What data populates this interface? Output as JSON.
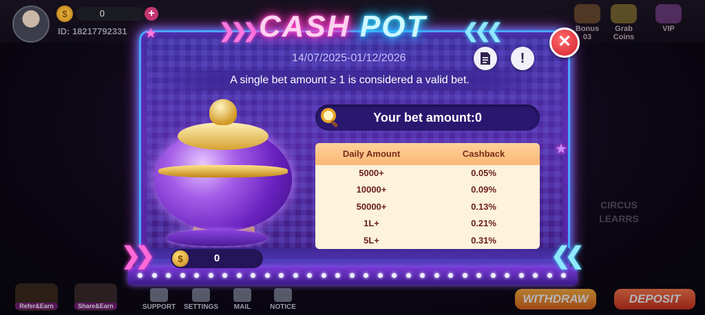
{
  "lobby": {
    "balance": "0",
    "uid": "ID: 18217792331",
    "top_items": [
      "Bonus",
      "Grab Coins",
      "VIP"
    ],
    "bonus_count": "03",
    "bottom_nav": [
      "Refer&Earn",
      "Share&Earn",
      "SUPPORT",
      "SETTINGS",
      "MAIL",
      "NOTICE"
    ],
    "withdraw_label": "WITHDRAW",
    "deposit_label": "DEPOSIT",
    "circus_text": "CIRCUS LEARRS"
  },
  "modal": {
    "title_part1": "CASH",
    "title_part2": "POT",
    "date_range": "14/07/2025-01/12/2026",
    "rules_icon": "document-icon",
    "info_icon": "exclamation-icon",
    "close_icon": "close-icon",
    "rule_text": "A single bet amount ≥ 1 is considered a valid bet.",
    "bet_amount_text": "Your bet amount:0",
    "pot_amount": "0",
    "table": {
      "headers": [
        "Daily Amount",
        "Cashback"
      ],
      "rows": [
        [
          "5000+",
          "0.05%"
        ],
        [
          "10000+",
          "0.09%"
        ],
        [
          "50000+",
          "0.13%"
        ],
        [
          "1L+",
          "0.21%"
        ],
        [
          "5L+",
          "0.31%"
        ]
      ]
    }
  },
  "colors": {
    "neon_pink": "#ff4fd2",
    "neon_blue": "#38d9ff",
    "panel_purple": "#5329a2",
    "table_header": "#f8b874",
    "table_body": "#fdf2dc",
    "close_red": "#d11e2a"
  }
}
